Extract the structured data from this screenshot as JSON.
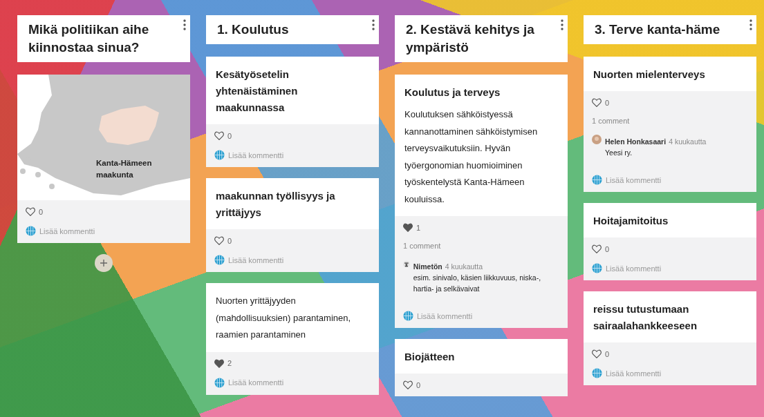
{
  "columns": [
    {
      "title": "Mikä politiikan aihe kiinnostaa sinua?",
      "add_button": true,
      "posts": [
        {
          "kind": "image",
          "map_label": "Kanta-Hämeen maakunta",
          "liked": false,
          "likes": "0",
          "add_comment": "Lisää kommentti"
        }
      ]
    },
    {
      "title": "1. Koulutus",
      "posts": [
        {
          "kind": "text",
          "title": "Kesätyösetelin yhtenäistäminen maakunnassa",
          "liked": false,
          "likes": "0",
          "add_comment": "Lisää kommentti"
        },
        {
          "kind": "text",
          "title": "maakunnan työllisyys ja yrittäjyys",
          "liked": false,
          "likes": "0",
          "add_comment": "Lisää kommentti"
        },
        {
          "kind": "text",
          "body": "Nuorten yrittäjyyden (mahdollisuuksien) parantaminen, raamien parantaminen",
          "liked": true,
          "likes": "2",
          "add_comment": "Lisää kommentti"
        }
      ]
    },
    {
      "title": "2. Kestävä kehitys ja ympäristö",
      "posts": [
        {
          "kind": "text",
          "title": "Koulutus ja terveys",
          "body": "Koulutuksen sähköistyessä kannanottaminen sähköistymisen terveysvaikutuksiin. Hyvän työergonomian huomioiminen työskentelystä Kanta-Hämeen kouluissa.",
          "liked": true,
          "likes": "1",
          "comment_count": "1 comment",
          "comments": [
            {
              "kind": "anonymous",
              "author": "Nimetön",
              "time": "4 kuukautta",
              "text": "esim. sinivalo, käsien liikkuvuus, niska-, hartia- ja selkävaivat"
            }
          ],
          "add_comment": "Lisää kommentti"
        },
        {
          "kind": "text",
          "title": "Biojätteen",
          "liked": false,
          "likes": "0"
        }
      ]
    },
    {
      "title": "3. Terve kanta-häme",
      "posts": [
        {
          "kind": "text",
          "title": "Nuorten mielenterveys",
          "liked": false,
          "likes": "0",
          "comment_count": "1 comment",
          "comments": [
            {
              "kind": "person",
              "author": "Helen Honkasaari",
              "time": "4 kuukautta",
              "text": "Yeesi ry."
            }
          ],
          "add_comment": "Lisää kommentti"
        },
        {
          "kind": "text",
          "title": "Hoitajamitoitus",
          "liked": false,
          "likes": "0",
          "add_comment": "Lisää kommentti"
        },
        {
          "kind": "text",
          "title": "reissu tutustumaan sairaalahankkeeseen",
          "liked": false,
          "likes": "0",
          "add_comment": "Lisää kommentti"
        }
      ]
    }
  ]
}
